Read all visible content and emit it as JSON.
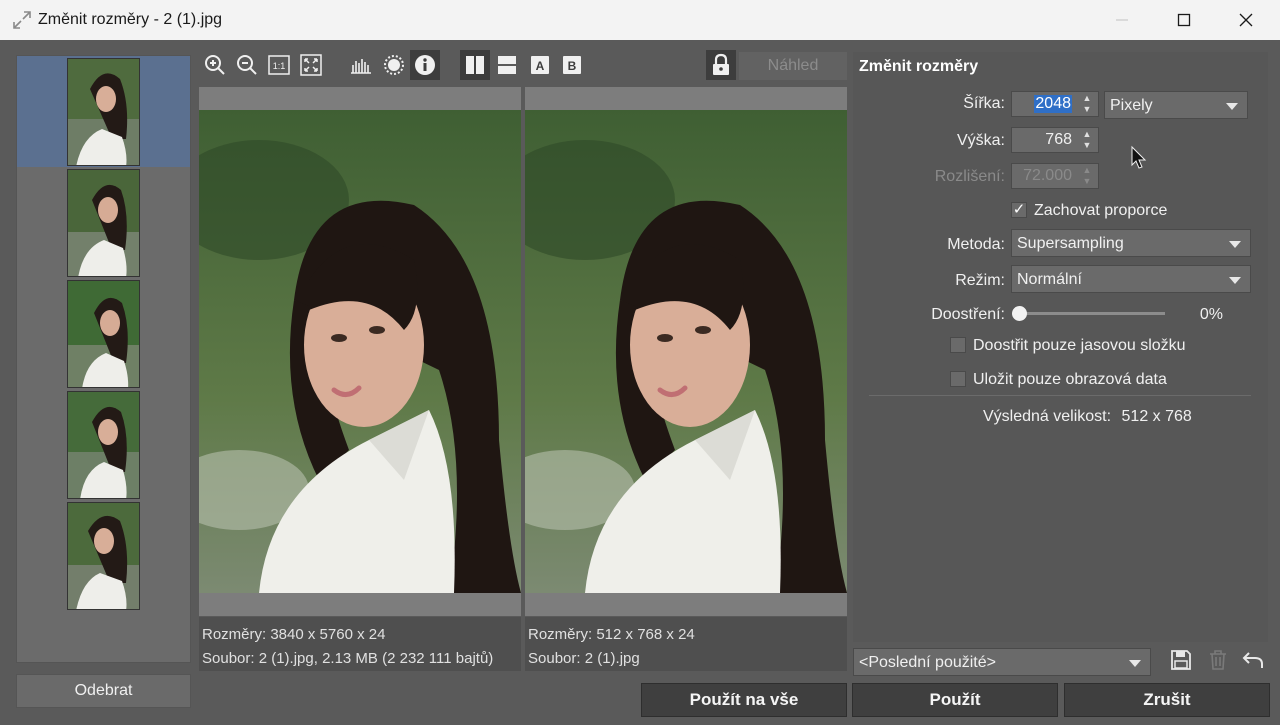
{
  "window": {
    "title": "Změnit rozměry - 2 (1).jpg"
  },
  "sidebar": {
    "thumbnails": [
      {
        "name": "thumb-1",
        "selected": true
      },
      {
        "name": "thumb-2",
        "selected": false
      },
      {
        "name": "thumb-3",
        "selected": false
      },
      {
        "name": "thumb-4",
        "selected": false
      },
      {
        "name": "thumb-5",
        "selected": false
      }
    ],
    "remove_label": "Odebrat"
  },
  "toolbar": {
    "icons": [
      "zoom-in-icon",
      "zoom-out-icon",
      "actual-size-icon",
      "fit-screen-icon",
      "histogram-icon",
      "exposure-icon",
      "info-icon",
      "split-vertical-icon",
      "split-horizontal-icon",
      "view-a-icon",
      "view-b-icon",
      "lock-icon"
    ],
    "view_a": "A",
    "view_b": "B",
    "one_to_one": "1:1",
    "preview_label": "Náhled"
  },
  "preview": {
    "left": {
      "dimensions": "Rozměry: 3840 x 5760 x 24",
      "file": "Soubor: 2 (1).jpg, 2.13 MB (2 232 111 bajtů)"
    },
    "right": {
      "dimensions": "Rozměry: 512 x 768 x 24",
      "file": "Soubor: 2 (1).jpg"
    }
  },
  "panel": {
    "title": "Změnit rozměry",
    "width_label": "Šířka:",
    "width_value": "2048",
    "unit_value": "Pixely",
    "height_label": "Výška:",
    "height_value": "768",
    "resolution_label": "Rozlišení:",
    "resolution_value": "72.000",
    "keep_ratio_label": "Zachovat proporce",
    "keep_ratio_checked": true,
    "method_label": "Metoda:",
    "method_value": "Supersampling",
    "mode_label": "Režim:",
    "mode_value": "Normální",
    "sharpen_label": "Doostření:",
    "sharpen_value": "0%",
    "sharpen_fraction": 0,
    "luma_only_label": "Doostřit pouze jasovou složku",
    "image_only_label": "Uložit pouze obrazová data",
    "result_label": "Výsledná velikost:",
    "result_value": "512 x 768"
  },
  "bottom": {
    "preset_value": "<Poslední použité>",
    "apply_all_label": "Použít na vše",
    "apply_label": "Použít",
    "cancel_label": "Zrušit"
  },
  "colors": {
    "selection": "#5b7090",
    "panel_bg": "#575757",
    "button_bg": "#3f3f3f",
    "titlebar_bg": "#f3f3f3"
  }
}
